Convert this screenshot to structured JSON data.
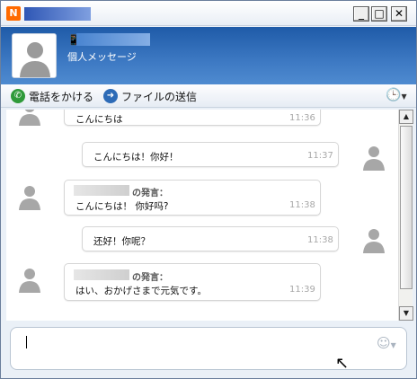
{
  "titlebar": {
    "app_icon": "N",
    "minimize": "_",
    "maximize": "□",
    "close": "✕"
  },
  "contact": {
    "phone_icon": "📱",
    "subtitle": "個人メッセージ"
  },
  "toolbar": {
    "call_label": "電話をかける",
    "file_label": "ファイルの送信",
    "history_icon": "🕒"
  },
  "messages": [
    {
      "side": "left",
      "text": "こんにちは",
      "time": "11:36"
    },
    {
      "side": "right",
      "text": "こんにちは！你好！",
      "time": "11:37"
    },
    {
      "side": "left",
      "sender_suffix": "の発言：",
      "text": "こんにちは！ 你好吗?",
      "time": "11:38"
    },
    {
      "side": "right",
      "text": "还好！你呢？",
      "time": "11:38"
    },
    {
      "side": "left",
      "sender_suffix": "の発言：",
      "text": "はい、おかげさまで元気です。",
      "time": "11:39"
    }
  ],
  "input": {
    "value": "",
    "placeholder": ""
  },
  "icons": {
    "emoticon": "☺",
    "cursor": "↖"
  }
}
